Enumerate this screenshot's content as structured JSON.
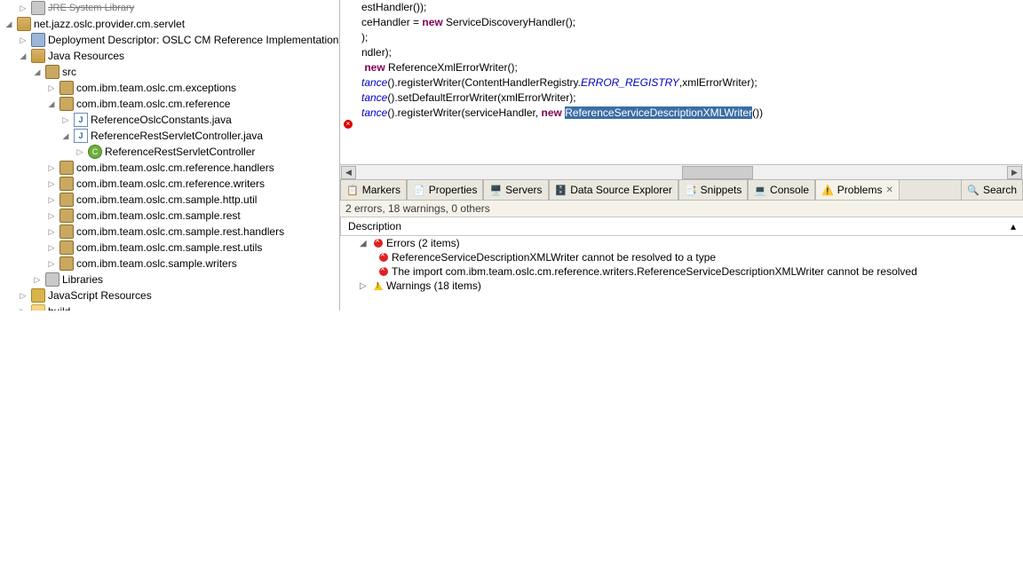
{
  "tree": {
    "jre_label": "JRE System Library",
    "project": "net.jazz.oslc.provider.cm.servlet",
    "deploy": "Deployment Descriptor: OSLC CM Reference Implementation",
    "java_resources": "Java Resources",
    "src": "src",
    "pkg_exceptions": "com.ibm.team.oslc.cm.exceptions",
    "pkg_reference": "com.ibm.team.oslc.cm.reference",
    "file_constants": "ReferenceOslcConstants.java",
    "file_controller": "ReferenceRestServletController.java",
    "class_controller": "ReferenceRestServletController",
    "pkg_handlers": "com.ibm.team.oslc.cm.reference.handlers",
    "pkg_writers": "com.ibm.team.oslc.cm.reference.writers",
    "pkg_http_util": "com.ibm.team.oslc.cm.sample.http.util",
    "pkg_rest": "com.ibm.team.oslc.cm.sample.rest",
    "pkg_rest_handlers": "com.ibm.team.oslc.cm.sample.rest.handlers",
    "pkg_rest_utils": "com.ibm.team.oslc.cm.sample.rest.utils",
    "pkg_sample_writers": "com.ibm.team.oslc.sample.writers",
    "libraries": "Libraries",
    "js_resources": "JavaScript Resources",
    "build": "build"
  },
  "code": {
    "l1": "estHandler());",
    "l2a": "ceHandler = ",
    "l2b": "new",
    "l2c": " ServiceDiscoveryHandler();",
    "l3": ");",
    "l4": "",
    "l5": "ndler);",
    "l6a": " ",
    "l6b": "new",
    "l6c": " ReferenceXmlErrorWriter();",
    "l7a": "tance",
    "l7b": "().registerWriter(ContentHandlerRegistry.",
    "l7c": "ERROR_REGISTRY",
    "l7d": ",xmlErrorWriter);",
    "l8a": "tance",
    "l8b": "().setDefaultErrorWriter(xmlErrorWriter);",
    "l9a": "tance",
    "l9b": "().registerWriter(serviceHandler, ",
    "l9c": "new",
    "l9d": " ",
    "l9e": "ReferenceServiceDescriptionXMLWriter",
    "l9f": "())"
  },
  "tabs": {
    "markers": "Markers",
    "properties": "Properties",
    "servers": "Servers",
    "dse": "Data Source Explorer",
    "snippets": "Snippets",
    "console": "Console",
    "problems": "Problems",
    "search": "Search"
  },
  "problems": {
    "summary": "2 errors, 18 warnings, 0 others",
    "colhead": "Description",
    "errors_label": "Errors (2 items)",
    "err1": "ReferenceServiceDescriptionXMLWriter cannot be resolved to a type",
    "err2": "The import com.ibm.team.oslc.cm.reference.writers.ReferenceServiceDescriptionXMLWriter cannot be resolved",
    "warnings_label": "Warnings (18 items)"
  }
}
